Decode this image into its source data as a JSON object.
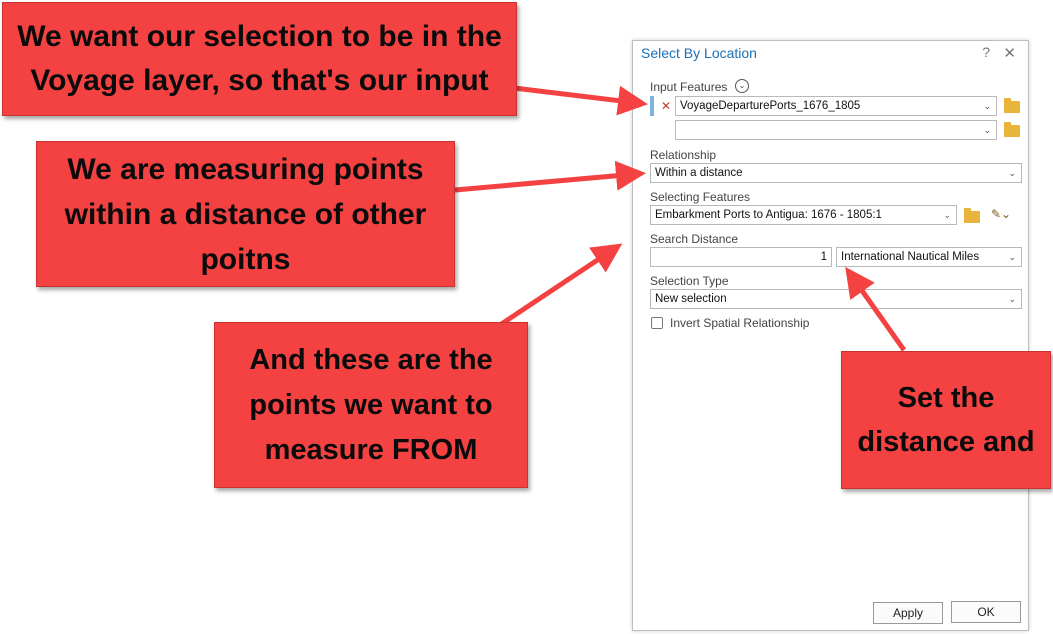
{
  "dialog": {
    "title": "Select By Location",
    "help_glyph": "?",
    "close_glyph": "✕",
    "input_features": {
      "label": "Input Features",
      "rows": [
        "VoyageDeparturePorts_1676_1805",
        ""
      ]
    },
    "relationship": {
      "label": "Relationship",
      "value": "Within a distance"
    },
    "selecting_features": {
      "label": "Selecting Features",
      "value": "Embarkment Ports to Antigua: 1676 - 1805:1"
    },
    "search_distance": {
      "label": "Search Distance",
      "value": "1",
      "unit": "International Nautical Miles"
    },
    "selection_type": {
      "label": "Selection Type",
      "value": "New selection"
    },
    "invert_label": "Invert Spatial Relationship",
    "apply_label": "Apply",
    "ok_label": "OK"
  },
  "callouts": {
    "input": [
      "We want our selection to be in the",
      "Voyage layer, so that's our input"
    ],
    "relationship": [
      "We are measuring points",
      "within a distance of other",
      "poitns"
    ],
    "selecting": [
      "And these are the",
      "points we want to",
      "measure FROM"
    ],
    "distance": [
      "Set the",
      "distance and"
    ]
  },
  "colors": {
    "callout": "#f44242",
    "title": "#1a6fb5",
    "folder": "#e8b43c"
  }
}
